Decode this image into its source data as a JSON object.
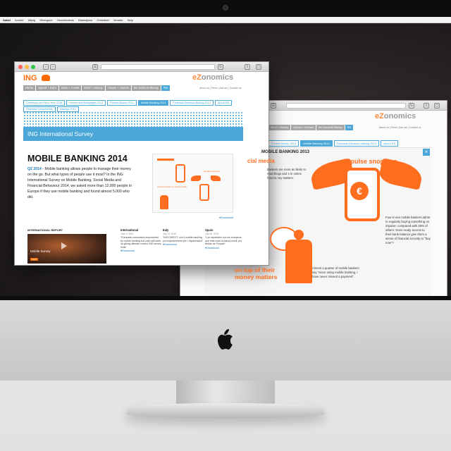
{
  "menubar": [
    "Safari",
    "Archief",
    "Wijzig",
    "Weergave",
    "Geschiedenis",
    "Bladwijzers",
    "Ontwikkel",
    "Venster",
    "Help"
  ],
  "front_window": {
    "ing_logo": "ING",
    "ezonomics_logo_e": "e",
    "ezonomics_logo_z": "Z",
    "ezonomics_logo_rest": "onomics",
    "nav": [
      "Home",
      "Spend + Earn",
      "Save + Invest",
      "Mind + Money",
      "House + Homes",
      "Be Good At Money",
      "RS"
    ],
    "util": "About us  |  Press  |  Ask Ian  |  Contact us",
    "tabs": [
      "Christmas and New Year 2015",
      "Homes and Mortgages 2014",
      "Pocket Money 2014",
      "Mobile Banking 2014",
      "Financial Decision Making 2014",
      "About RS",
      "Financial Competence",
      "Savings 2012"
    ],
    "selected_tab_index": 3,
    "banner": "ING International Survey",
    "heading": "MOBILE BANKING 2014",
    "lead_label": "Q2 2014",
    "lead_text": " - Mobile banking allows people to manage their money on the go. But what types of people use it most? In the ING International Survey on Mobile Banking, Social Media and Financial Behaviour 2014, we asked more than 12,000 people in Europe if they use mobile banking and found almost 5,000 who did.",
    "infographic": {
      "text1": "well connected on social media",
      "text2": "impulse shoppers"
    },
    "download": "Download",
    "report_title": "INTERNATIONAL REPORT",
    "video_title": "Mobile Survey",
    "video_badge": "NEW",
    "columns": [
      {
        "heading": "International",
        "date": "June 3, 2014",
        "text": "\"European consumers empowered by mobile banking but cash still seen as giving ultimate control, ING survey finds\"",
        "link": "Download"
      },
      {
        "heading": "Italy",
        "date": "July 10, 2015",
        "text": "\"ING DIRECT: con il mobile banking più empowerment per i risparmiatori\"",
        "link": "Download"
      },
      {
        "heading": "Spain",
        "date": "July 06, 2015",
        "text": "\"Los españoles con los europeos que más usan la banca móvil, por detrás de Turquía\"",
        "link": "Download"
      }
    ]
  },
  "back_window": {
    "logo_e": "e",
    "logo_z": "Z",
    "logo_rest": "onomics",
    "nav": [
      "Mind + Money",
      "House + Homes",
      "Be Good At Money",
      "RS"
    ],
    "util": "About us  |  Press  |  Ask Ian  |  Contact us",
    "tabs": [
      "Pocket Money 2014",
      "Mobile Banking 2014",
      "Financial Decision Making 2014",
      "About RS"
    ],
    "selected_tab_index": 1,
    "close": "×",
    "panel_title": "MOBILE BANKING 2013",
    "h1": "cial media",
    "h2": "impulse snoppers",
    "txt1": "bankers are more as likely to read blogs and s in online forums ney matters.",
    "coin": "€",
    "txt2": "Four-in-ten mobile bankers admit to regularly buying something on impulse, compared with 28% of others. Does ready access to their bank balance give them a sense of financial security to \"buy now\"?",
    "h3": "on top of their money matters",
    "txt3": "Almost a quarter of mobile bankers say \"since using mobile banking, I have never missed a payment\"."
  },
  "colors": {
    "ing_orange": "#ff6a00",
    "accent_blue": "#4aa7d8",
    "infographic_orange": "#ff6d1f"
  }
}
